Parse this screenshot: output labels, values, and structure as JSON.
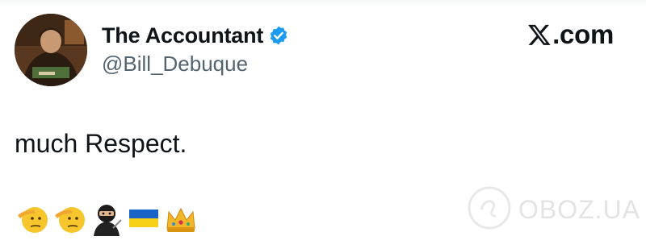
{
  "profile": {
    "display_name": "The Accountant",
    "handle": "@Bill_Debuque",
    "verified": true,
    "verified_color": "#1d9bf0",
    "avatar_icon": "portrait-painting-avatar"
  },
  "brand": {
    "label": "com",
    "icon": "x-logo-icon"
  },
  "tweet": {
    "text": "much Respect.",
    "emojis": [
      "saluting-face",
      "saluting-face",
      "ninja",
      "ukraine-flag",
      "crown"
    ]
  },
  "watermark": {
    "text": "OBOZ.UA",
    "icon": "oboz-logo-icon"
  }
}
